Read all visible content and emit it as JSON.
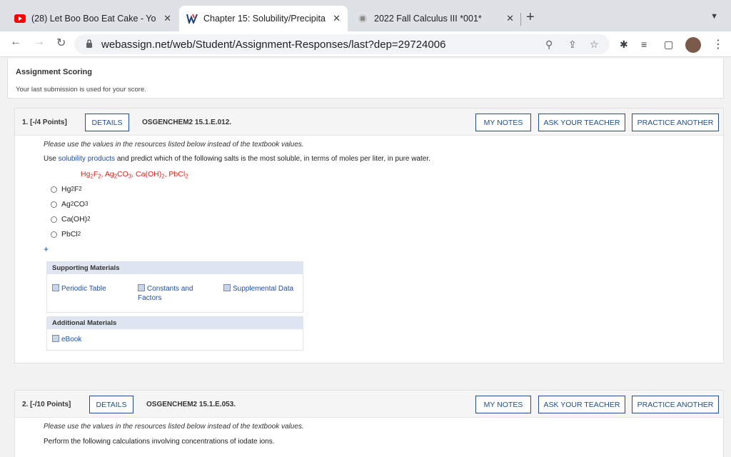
{
  "browser": {
    "tabs": [
      {
        "title": "(28) Let Boo Boo Eat Cake - Yo",
        "icon": "youtube-icon"
      },
      {
        "title": "Chapter 15: Solubility/Precipita",
        "icon": "webassign-icon"
      },
      {
        "title": "2022 Fall Calculus III *001*",
        "icon": "university-icon"
      }
    ],
    "url": "webassign.net/web/Student/Assignment-Responses/last?dep=29724006"
  },
  "scoring": {
    "title": "Assignment Scoring",
    "text": "Your last submission is used for your score."
  },
  "buttons": {
    "details": "DETAILS",
    "my_notes": "MY NOTES",
    "ask_teacher": "ASK YOUR TEACHER",
    "practice": "PRACTICE ANOTHER"
  },
  "q1": {
    "points": "1.  [-/4 Points]",
    "code": "OSGENCHEM2 15.1.E.012.",
    "note": "Please use the values in the resources listed below instead of the textbook values.",
    "prompt_pre": "Use ",
    "prompt_link": "solubility products",
    "prompt_post": " and predict which of the following salts is the most soluble, in terms of moles per liter, in pure water.",
    "plus": "+",
    "supporting_title": "Supporting Materials",
    "materials": [
      "Periodic Table",
      "Constants and Factors",
      "Supplemental Data"
    ],
    "additional_title": "Additional Materials",
    "ebook": "eBook"
  },
  "q2": {
    "points": "2.  [-/10 Points]",
    "code": "OSGENCHEM2 15.1.E.053.",
    "note": "Please use the values in the resources listed below instead of the textbook values.",
    "prompt": "Perform the following calculations involving concentrations of iodate ions."
  },
  "colors": {
    "accent": "#1f4e8a",
    "red_formula": "#d8261f",
    "panel_header": "#dfe6f1"
  }
}
